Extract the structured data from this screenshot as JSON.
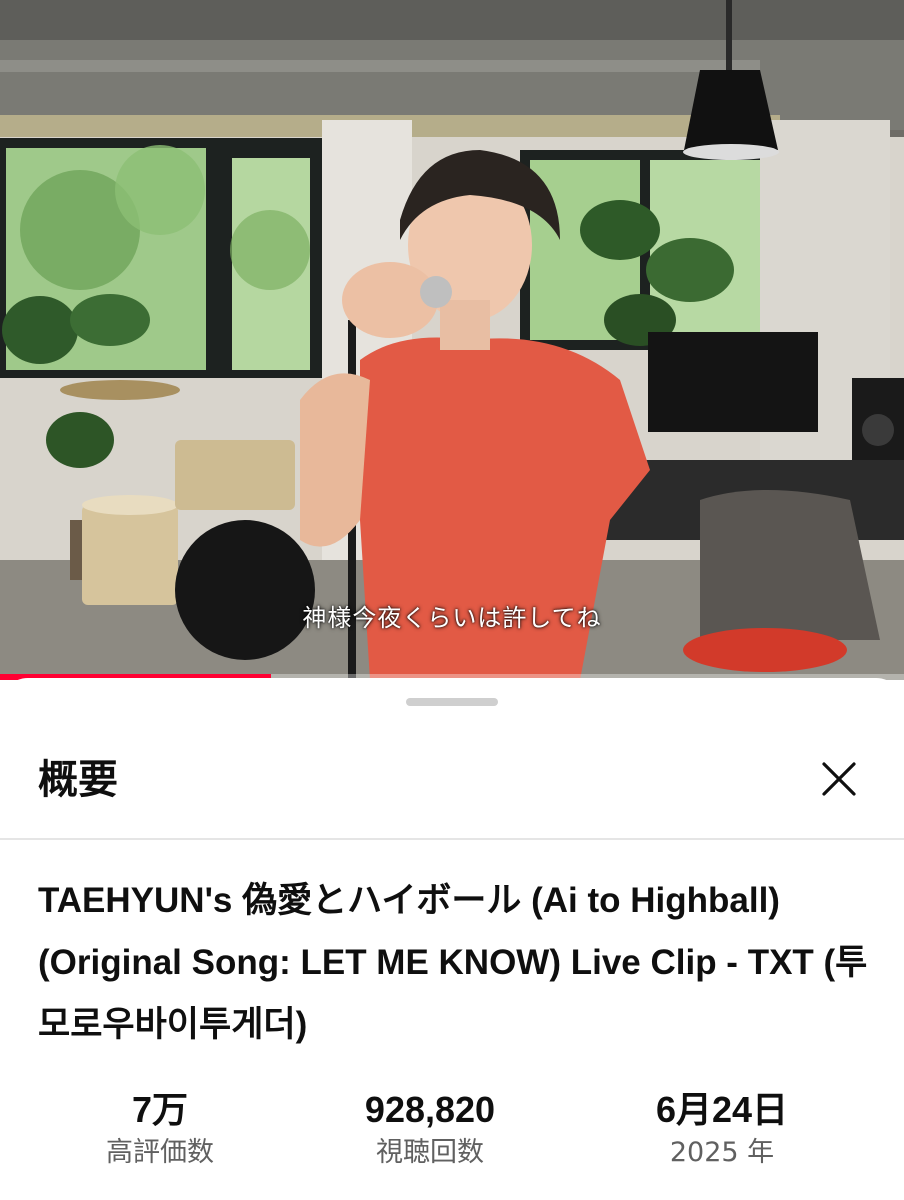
{
  "player": {
    "subtitle": "神様今夜くらいは許してね",
    "progress_fraction": 0.3,
    "progress_color": "#ff0033"
  },
  "description_panel": {
    "heading": "概要",
    "close_icon": "close-icon",
    "video_title": "TAEHYUN's 偽愛とハイボール (Ai to Highball) (Original Song: LET ME KNOW) Live Clip - TXT (투모로우바이투게더)",
    "stats": [
      {
        "value": "7万",
        "label": "高評価数"
      },
      {
        "value": "928,820",
        "label": "視聴回数"
      },
      {
        "value": "6月24日",
        "label": "2025 年"
      }
    ]
  }
}
